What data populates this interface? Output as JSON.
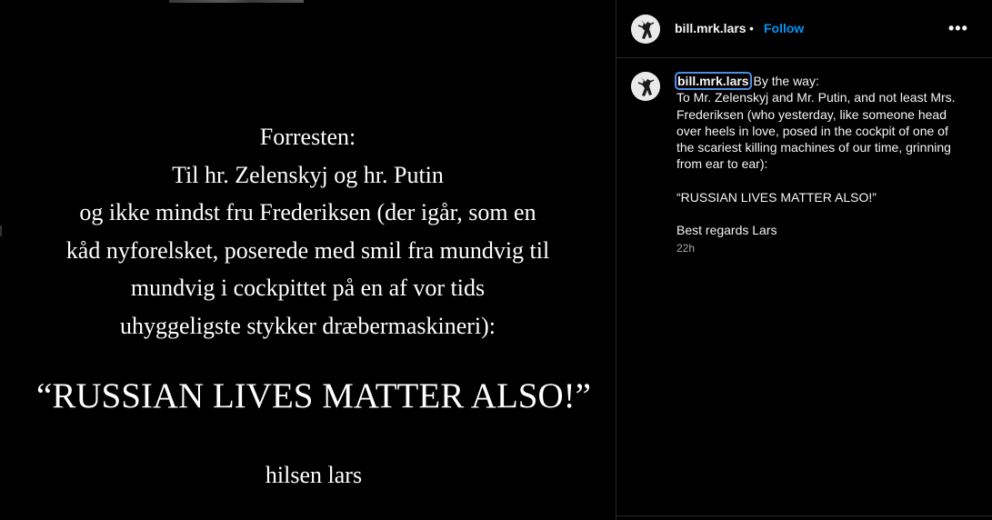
{
  "post_image": {
    "lines": [
      "Forresten:",
      "Til hr. Zelenskyj og hr. Putin",
      "og ikke mindst fru Frederiksen (der igår, som en",
      "kåd nyforelsket, poserede med smil fra mundvig til",
      "mundvig i cockpittet på en af vor tids",
      "uhyggeligste stykker dræbermaskineri):"
    ],
    "headline": "“RUSSIAN LIVES MATTER ALSO!”",
    "signature": "hilsen lars"
  },
  "header": {
    "username": "bill.mrk.lars",
    "separator": "•",
    "follow_label": "Follow",
    "more_label": "•••"
  },
  "caption": {
    "username": "bill.mrk.lars",
    "first_line": "By the way:",
    "body": "To Mr. Zelenskyj and Mr. Putin, and not least Mrs. Frederiksen (who yesterday, like someone head over heels in love, posed in the cockpit of one of the scariest killing machines of our time, grinning from ear to ear):",
    "quote": "“RUSSIAN LIVES MATTER ALSO!”",
    "signoff": "Best regards Lars",
    "time": "22h"
  },
  "colors": {
    "accent": "#0095f6",
    "background": "#000000",
    "divider": "#262626",
    "muted": "#a8a8a8"
  }
}
